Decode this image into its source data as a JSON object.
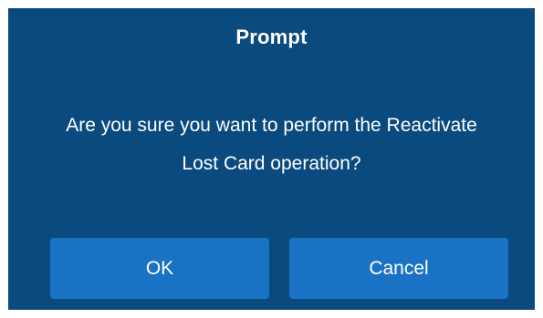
{
  "dialog": {
    "title": "Prompt",
    "message_line1": "Are you sure you want to perform the Reactivate",
    "message_line2": "Lost Card operation?",
    "ok_label": "OK",
    "cancel_label": "Cancel"
  },
  "colors": {
    "dialog_background": "#0b4a7e",
    "button_background": "#1a72c4",
    "text": "#ffffff"
  }
}
